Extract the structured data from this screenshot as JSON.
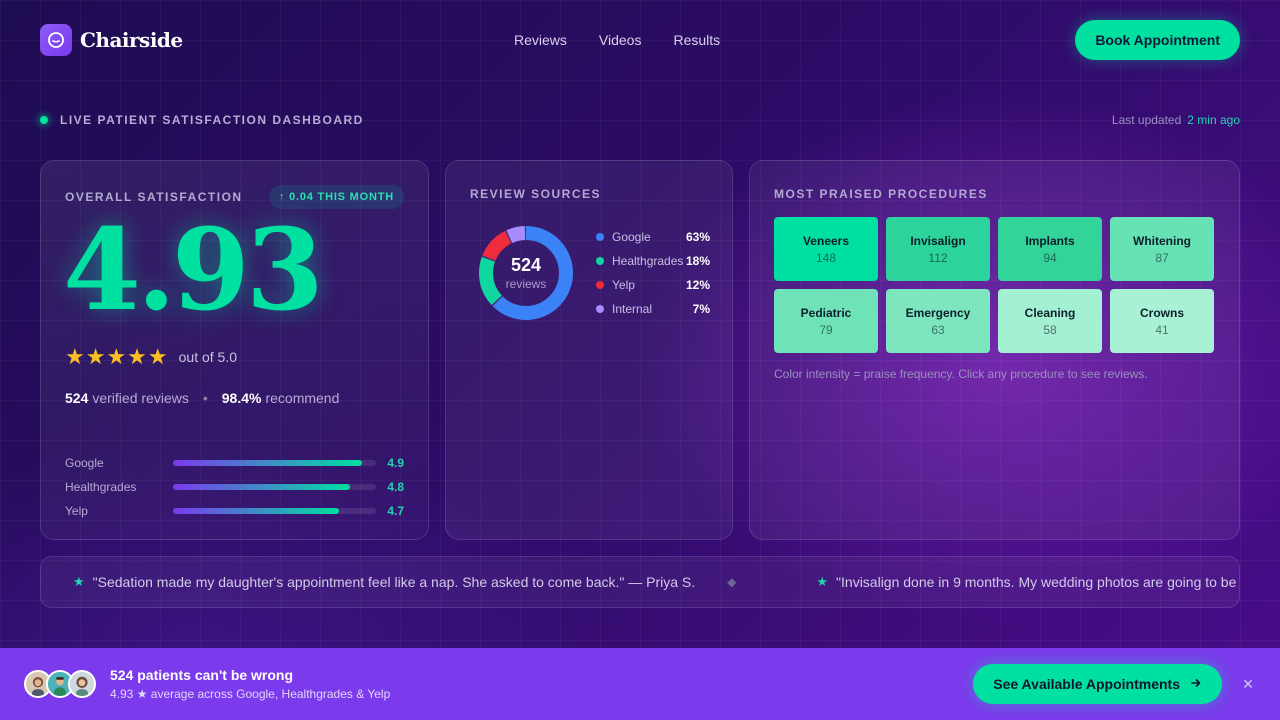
{
  "brand": {
    "name": "Chairside",
    "icon": "smile-icon"
  },
  "nav": {
    "items": [
      "Reviews",
      "Videos",
      "Results"
    ]
  },
  "header": {
    "cta_label": "Book Appointment"
  },
  "status": {
    "label": "LIVE PATIENT SATISFACTION DASHBOARD",
    "updated_label": "Last updated",
    "updated_time": "2 min ago"
  },
  "overall": {
    "title": "OVERALL SATISFACTION",
    "trend": "↑ 0.04 THIS MONTH",
    "score": "4.93",
    "stars": "★★★★★",
    "out_of": "out of 5.0",
    "verified_count": "524",
    "verified_label": "verified reviews",
    "separator": "•",
    "recommend_pct": "98.4%",
    "recommend_label": "recommend",
    "sources": [
      {
        "name": "Google",
        "score": "4.9",
        "fill_pct": 93
      },
      {
        "name": "Healthgrades",
        "score": "4.8",
        "fill_pct": 87
      },
      {
        "name": "Yelp",
        "score": "4.7",
        "fill_pct": 82
      }
    ]
  },
  "review_sources": {
    "title": "REVIEW SOURCES",
    "total": "524",
    "total_label": "reviews",
    "items": [
      {
        "name": "Google",
        "pct": "63%",
        "value": 63,
        "color": "#3b82f6"
      },
      {
        "name": "Healthgrades",
        "pct": "18%",
        "value": 18,
        "color": "#10d6a0"
      },
      {
        "name": "Yelp",
        "pct": "12%",
        "value": 12,
        "color": "#ef2b3c"
      },
      {
        "name": "Internal",
        "pct": "7%",
        "value": 7,
        "color": "#a78bfa"
      }
    ]
  },
  "procedures": {
    "title": "MOST PRAISED PROCEDURES",
    "tiles": [
      {
        "name": "Veneers",
        "count": "148",
        "color": "#00e0a0"
      },
      {
        "name": "Invisalign",
        "count": "112",
        "color": "#2cd39a"
      },
      {
        "name": "Implants",
        "count": "94",
        "color": "#33d49a"
      },
      {
        "name": "Whitening",
        "count": "87",
        "color": "#66e2b4"
      },
      {
        "name": "Pediatric",
        "count": "79",
        "color": "#6ee3b8"
      },
      {
        "name": "Emergency",
        "count": "63",
        "color": "#7ee6bf"
      },
      {
        "name": "Cleaning",
        "count": "58",
        "color": "#a4f0d2"
      },
      {
        "name": "Crowns",
        "count": "41",
        "color": "#a9f1d4"
      }
    ],
    "note": "Color intensity = praise frequency. Click any procedure to see reviews."
  },
  "ticker": {
    "star": "★",
    "separator": "◆",
    "quotes": [
      "\"Sedation made my daughter's appointment feel like a nap. She asked to come back.\" — Priya S.",
      "\"Invisalign done in 9 months. My wedding photos are going to be"
    ]
  },
  "promo": {
    "title": "524 patients can't be wrong",
    "subtitle": "4.93 ★ average across Google, Healthgrades & Yelp",
    "cta_label": "See Available Appointments",
    "cta_icon": "arrow-right-icon",
    "close_icon": "close-icon",
    "close_glyph": "×"
  }
}
